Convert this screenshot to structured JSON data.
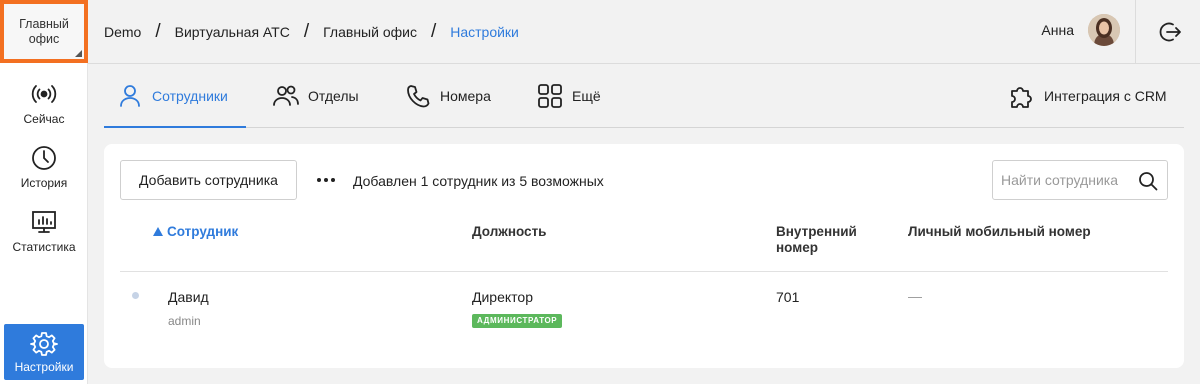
{
  "sidebar": {
    "office": "Главный офис",
    "items": [
      {
        "label": "Сейчас",
        "icon": "broadcast-icon"
      },
      {
        "label": "История",
        "icon": "clock-icon"
      },
      {
        "label": "Статистика",
        "icon": "chart-icon"
      },
      {
        "label": "Настройки",
        "icon": "gear-icon"
      }
    ]
  },
  "header": {
    "breadcrumbs": [
      "Demo",
      "Виртуальная АТС",
      "Главный офис",
      "Настройки"
    ],
    "separator": "/",
    "user_name": "Анна"
  },
  "tabs": [
    {
      "label": "Сотрудники",
      "icon": "person-icon",
      "active": true
    },
    {
      "label": "Отделы",
      "icon": "people-icon"
    },
    {
      "label": "Номера",
      "icon": "phone-icon"
    },
    {
      "label": "Ещё",
      "icon": "grid-icon"
    },
    {
      "label": "Интеграция с CRM",
      "icon": "puzzle-icon"
    }
  ],
  "toolbar": {
    "add_label": "Добавить сотрудника",
    "added_text": "Добавлен 1 сотрудник из 5 возможных",
    "search_placeholder": "Найти сотрудника"
  },
  "table": {
    "columns": [
      "Сотрудник",
      "Должность",
      "Внутренний номер",
      "Личный мобильный номер"
    ],
    "rows": [
      {
        "name": "Давид",
        "login": "admin",
        "position": "Директор",
        "role_badge": "АДМИНИСТРАТОР",
        "ext": "701",
        "mobile": "—"
      }
    ]
  },
  "colors": {
    "accent": "#2f7bdc",
    "highlight": "#f37021",
    "badge": "#5cb85c"
  }
}
